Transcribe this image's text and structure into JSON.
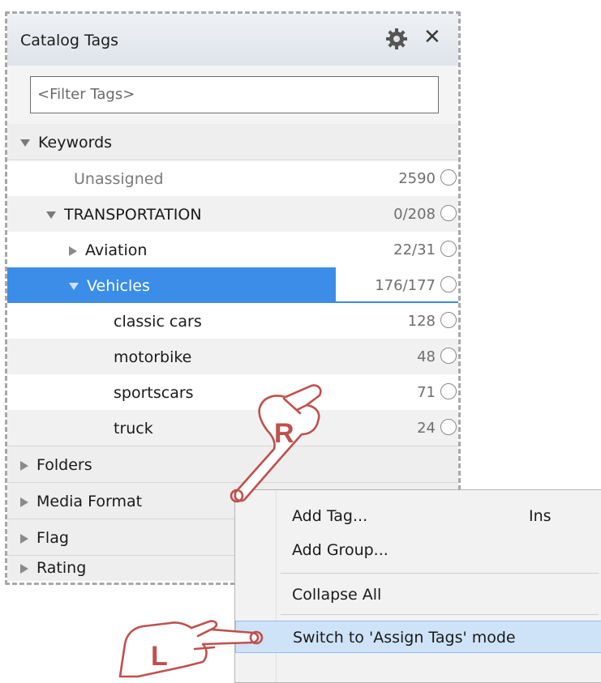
{
  "panel": {
    "title": "Catalog Tags",
    "filter_placeholder": "<Filter Tags>",
    "keywords_header": "Keywords",
    "tree": [
      {
        "label": "Unassigned",
        "count": "2590"
      },
      {
        "label": "TRANSPORTATION",
        "count": "0/208"
      },
      {
        "label": "Aviation",
        "count": "22/31"
      },
      {
        "label": "Vehicles",
        "count": "176/177",
        "selected": true
      },
      {
        "label": "classic cars",
        "count": "128"
      },
      {
        "label": "motorbike",
        "count": "48"
      },
      {
        "label": "sportscars",
        "count": "71"
      },
      {
        "label": "truck",
        "count": "24"
      }
    ],
    "sections": [
      "Folders",
      "Media Format",
      "Flag",
      "Rating"
    ]
  },
  "menu": {
    "items": [
      {
        "label": "Add Tag...",
        "shortcut": "Ins"
      },
      {
        "label": "Add Group..."
      },
      {
        "label": "Collapse All"
      },
      {
        "label": "Switch to 'Assign Tags' mode",
        "highlighted": true
      }
    ]
  },
  "hands": {
    "right_click_letter": "R",
    "left_click_letter": "L"
  },
  "colors": {
    "selection": "#3b8de8",
    "menu_highlight": "#cfe3f8",
    "hand_outline": "#c0504d"
  },
  "icons": [
    "gear-icon",
    "close-icon",
    "chevron-down-icon",
    "chevron-right-icon",
    "radio-icon",
    "hand-pointer-icon"
  ]
}
